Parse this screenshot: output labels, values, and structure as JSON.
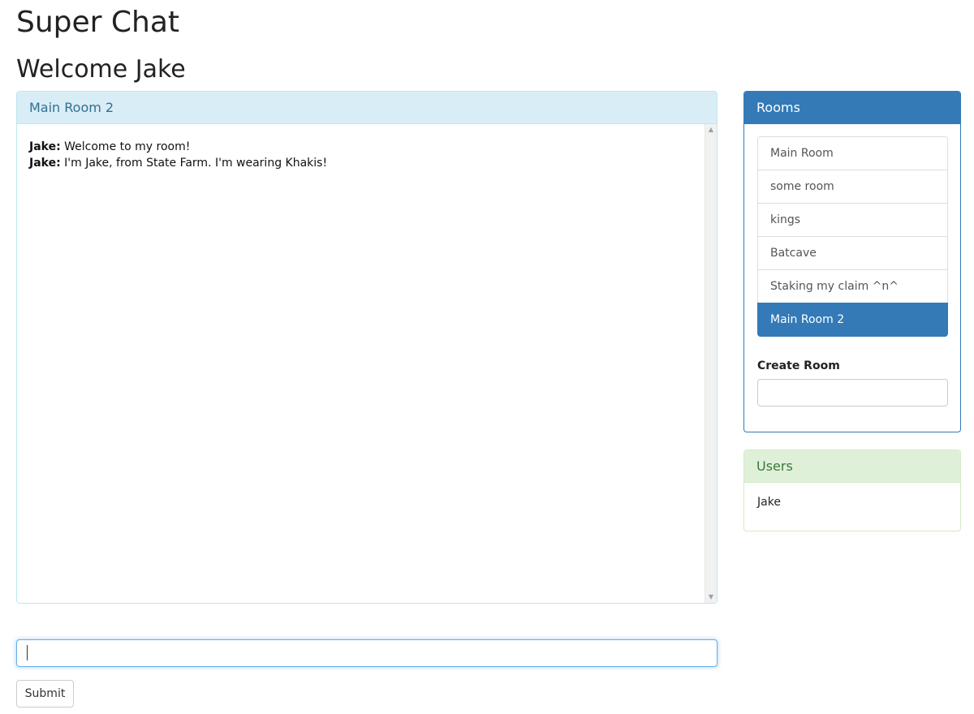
{
  "app": {
    "title": "Super Chat",
    "welcome": "Welcome Jake"
  },
  "chat": {
    "room_name": "Main Room 2",
    "messages": [
      {
        "user": "Jake:",
        "text": " Welcome to my room!"
      },
      {
        "user": "Jake:",
        "text": " I'm Jake, from State Farm. I'm wearing Khakis!"
      }
    ],
    "input_value": "",
    "submit_label": "Submit"
  },
  "rooms": {
    "heading": "Rooms",
    "items": [
      {
        "label": "Main Room"
      },
      {
        "label": "some room"
      },
      {
        "label": "kings"
      },
      {
        "label": "Batcave"
      },
      {
        "label": "Staking my claim ^n^"
      },
      {
        "label": "Main Room 2",
        "active": true
      }
    ],
    "create_label": "Create Room",
    "create_value": ""
  },
  "users": {
    "heading": "Users",
    "list": [
      "Jake"
    ]
  },
  "colors": {
    "primary": "#337ab7",
    "info_bg": "#d9edf7",
    "info_text": "#31708f",
    "success_bg": "#dff0d8",
    "success_text": "#3c763d"
  },
  "icons": {
    "scroll_up": "triangle-up-icon",
    "scroll_down": "triangle-down-icon"
  }
}
